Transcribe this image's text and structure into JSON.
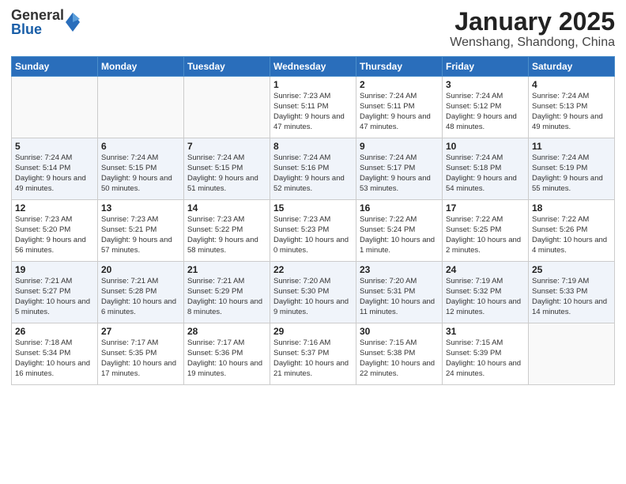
{
  "header": {
    "logo_general": "General",
    "logo_blue": "Blue",
    "month_title": "January 2025",
    "location": "Wenshang, Shandong, China"
  },
  "weekdays": [
    "Sunday",
    "Monday",
    "Tuesday",
    "Wednesday",
    "Thursday",
    "Friday",
    "Saturday"
  ],
  "weeks": [
    [
      {
        "day": "",
        "info": ""
      },
      {
        "day": "",
        "info": ""
      },
      {
        "day": "",
        "info": ""
      },
      {
        "day": "1",
        "info": "Sunrise: 7:23 AM\nSunset: 5:11 PM\nDaylight: 9 hours and 47 minutes."
      },
      {
        "day": "2",
        "info": "Sunrise: 7:24 AM\nSunset: 5:11 PM\nDaylight: 9 hours and 47 minutes."
      },
      {
        "day": "3",
        "info": "Sunrise: 7:24 AM\nSunset: 5:12 PM\nDaylight: 9 hours and 48 minutes."
      },
      {
        "day": "4",
        "info": "Sunrise: 7:24 AM\nSunset: 5:13 PM\nDaylight: 9 hours and 49 minutes."
      }
    ],
    [
      {
        "day": "5",
        "info": "Sunrise: 7:24 AM\nSunset: 5:14 PM\nDaylight: 9 hours and 49 minutes."
      },
      {
        "day": "6",
        "info": "Sunrise: 7:24 AM\nSunset: 5:15 PM\nDaylight: 9 hours and 50 minutes."
      },
      {
        "day": "7",
        "info": "Sunrise: 7:24 AM\nSunset: 5:15 PM\nDaylight: 9 hours and 51 minutes."
      },
      {
        "day": "8",
        "info": "Sunrise: 7:24 AM\nSunset: 5:16 PM\nDaylight: 9 hours and 52 minutes."
      },
      {
        "day": "9",
        "info": "Sunrise: 7:24 AM\nSunset: 5:17 PM\nDaylight: 9 hours and 53 minutes."
      },
      {
        "day": "10",
        "info": "Sunrise: 7:24 AM\nSunset: 5:18 PM\nDaylight: 9 hours and 54 minutes."
      },
      {
        "day": "11",
        "info": "Sunrise: 7:24 AM\nSunset: 5:19 PM\nDaylight: 9 hours and 55 minutes."
      }
    ],
    [
      {
        "day": "12",
        "info": "Sunrise: 7:23 AM\nSunset: 5:20 PM\nDaylight: 9 hours and 56 minutes."
      },
      {
        "day": "13",
        "info": "Sunrise: 7:23 AM\nSunset: 5:21 PM\nDaylight: 9 hours and 57 minutes."
      },
      {
        "day": "14",
        "info": "Sunrise: 7:23 AM\nSunset: 5:22 PM\nDaylight: 9 hours and 58 minutes."
      },
      {
        "day": "15",
        "info": "Sunrise: 7:23 AM\nSunset: 5:23 PM\nDaylight: 10 hours and 0 minutes."
      },
      {
        "day": "16",
        "info": "Sunrise: 7:22 AM\nSunset: 5:24 PM\nDaylight: 10 hours and 1 minute."
      },
      {
        "day": "17",
        "info": "Sunrise: 7:22 AM\nSunset: 5:25 PM\nDaylight: 10 hours and 2 minutes."
      },
      {
        "day": "18",
        "info": "Sunrise: 7:22 AM\nSunset: 5:26 PM\nDaylight: 10 hours and 4 minutes."
      }
    ],
    [
      {
        "day": "19",
        "info": "Sunrise: 7:21 AM\nSunset: 5:27 PM\nDaylight: 10 hours and 5 minutes."
      },
      {
        "day": "20",
        "info": "Sunrise: 7:21 AM\nSunset: 5:28 PM\nDaylight: 10 hours and 6 minutes."
      },
      {
        "day": "21",
        "info": "Sunrise: 7:21 AM\nSunset: 5:29 PM\nDaylight: 10 hours and 8 minutes."
      },
      {
        "day": "22",
        "info": "Sunrise: 7:20 AM\nSunset: 5:30 PM\nDaylight: 10 hours and 9 minutes."
      },
      {
        "day": "23",
        "info": "Sunrise: 7:20 AM\nSunset: 5:31 PM\nDaylight: 10 hours and 11 minutes."
      },
      {
        "day": "24",
        "info": "Sunrise: 7:19 AM\nSunset: 5:32 PM\nDaylight: 10 hours and 12 minutes."
      },
      {
        "day": "25",
        "info": "Sunrise: 7:19 AM\nSunset: 5:33 PM\nDaylight: 10 hours and 14 minutes."
      }
    ],
    [
      {
        "day": "26",
        "info": "Sunrise: 7:18 AM\nSunset: 5:34 PM\nDaylight: 10 hours and 16 minutes."
      },
      {
        "day": "27",
        "info": "Sunrise: 7:17 AM\nSunset: 5:35 PM\nDaylight: 10 hours and 17 minutes."
      },
      {
        "day": "28",
        "info": "Sunrise: 7:17 AM\nSunset: 5:36 PM\nDaylight: 10 hours and 19 minutes."
      },
      {
        "day": "29",
        "info": "Sunrise: 7:16 AM\nSunset: 5:37 PM\nDaylight: 10 hours and 21 minutes."
      },
      {
        "day": "30",
        "info": "Sunrise: 7:15 AM\nSunset: 5:38 PM\nDaylight: 10 hours and 22 minutes."
      },
      {
        "day": "31",
        "info": "Sunrise: 7:15 AM\nSunset: 5:39 PM\nDaylight: 10 hours and 24 minutes."
      },
      {
        "day": "",
        "info": ""
      }
    ]
  ]
}
